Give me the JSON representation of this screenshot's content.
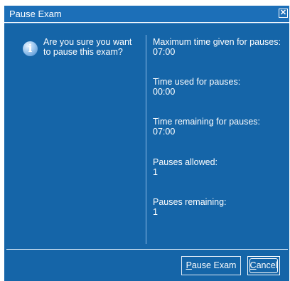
{
  "dialog": {
    "title": "Pause Exam",
    "close_glyph": "☒",
    "icon": "info-icon",
    "question": "Are you sure you want to pause this exam?",
    "stats": [
      {
        "label": "Maximum time given for pauses:",
        "value": "07:00"
      },
      {
        "label": "Time used for pauses:",
        "value": "00:00"
      },
      {
        "label": "Time remaining for pauses:",
        "value": "07:00"
      },
      {
        "label": "Pauses allowed:",
        "value": "1"
      },
      {
        "label": "Pauses remaining:",
        "value": "1"
      }
    ],
    "buttons": {
      "pause_accel": "P",
      "pause_rest": "ause Exam",
      "cancel_accel": "C",
      "cancel_rest": "ancel"
    }
  },
  "colors": {
    "titlebar": "#1c6fb8",
    "body": "#1565a8",
    "text": "#ffffff"
  }
}
